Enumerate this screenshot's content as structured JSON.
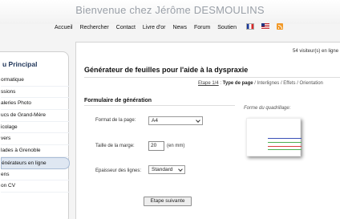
{
  "header": {
    "site_title": "Bienvenue chez Jérôme DESMOULINS",
    "nav": [
      "Accueil",
      "Rechercher",
      "Contact",
      "Livre d'or",
      "News",
      "Forum",
      "Soutien"
    ],
    "icons": [
      "flag-fr-icon",
      "flag-us-icon",
      "rss-icon"
    ]
  },
  "sidebar": {
    "title": "u Principal",
    "items": [
      {
        "label": "ormatique",
        "active": false
      },
      {
        "label": "ssions",
        "active": false
      },
      {
        "label": "aleries Photo",
        "active": false
      },
      {
        "label": "ucs de Grand-Mère",
        "active": false
      },
      {
        "label": "icolage",
        "active": false
      },
      {
        "label": "vers",
        "active": false
      },
      {
        "label": "lades à Grenoble",
        "active": false
      },
      {
        "label": "énérateurs en ligne",
        "active": true
      },
      {
        "label": "ens",
        "active": false
      },
      {
        "label": "on CV",
        "active": false
      }
    ]
  },
  "main": {
    "visitors": "54 visiteur(s) en ligne",
    "title": "Générateur de feuilles pour l'aide à la dyspraxie",
    "breadcrumb": {
      "step": "Etape 1/4",
      "separator": " : ",
      "current": "Type de page",
      "rest": " / Interlignes / Effets / Orientation"
    },
    "form": {
      "section_title": "Formulaire de génération",
      "format_label": "Format de la page:",
      "format_value": "A4",
      "marge_label": "Taille de la marge:",
      "marge_value": "20",
      "marge_unit": "(en mm)",
      "epaisseur_label": "Epaisseur des lignes:",
      "epaisseur_value": "Standard",
      "preview_label": "Forme du quadrillage:",
      "next_button": "Etape suivante"
    }
  }
}
